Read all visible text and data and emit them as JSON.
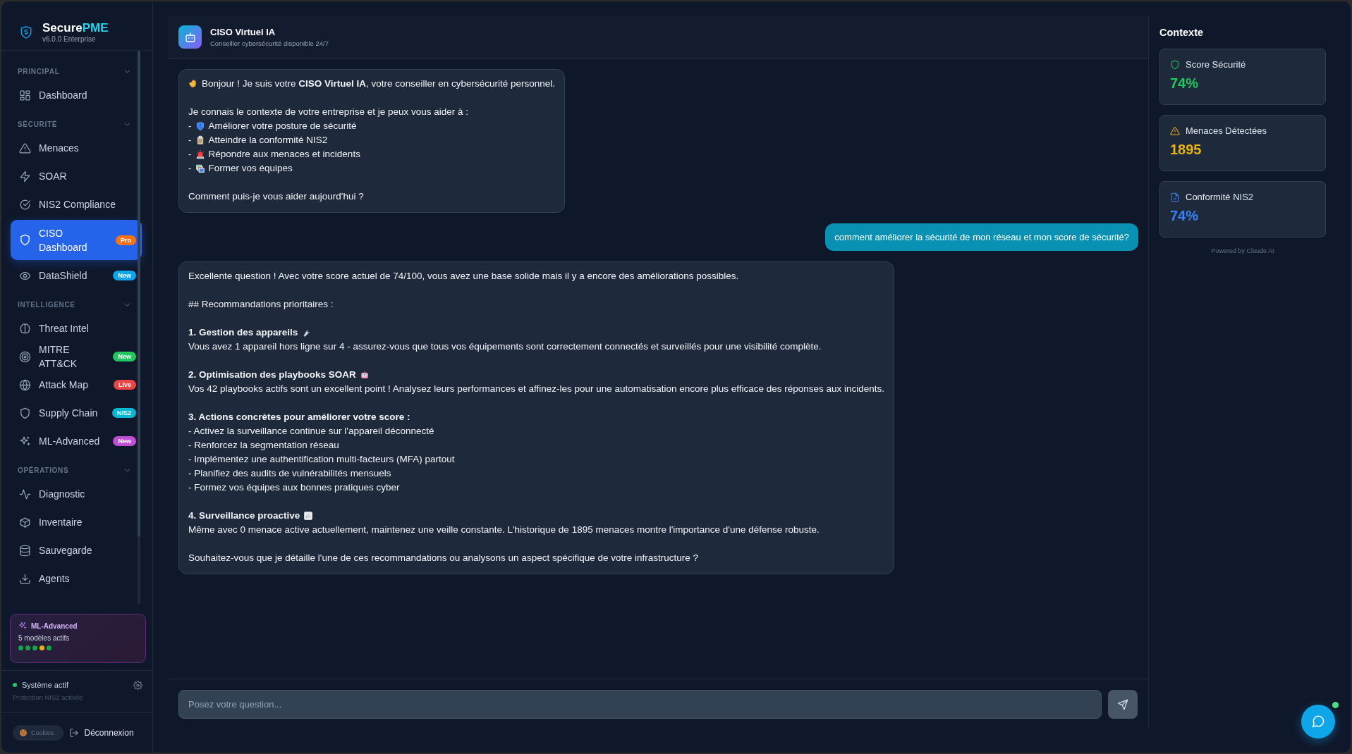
{
  "sidebar": {
    "brand": {
      "name": "Secure",
      "accent": "PME",
      "version": "v6.0.0 Enterprise"
    },
    "sections": [
      {
        "label": "PRINCIPAL",
        "expanded": true,
        "items": [
          {
            "label": "Dashboard",
            "selected": false
          }
        ]
      },
      {
        "label": "SÉCURITÉ",
        "expanded": true,
        "items": [
          {
            "label": "Menaces",
            "selected": false
          },
          {
            "label": "SOAR",
            "selected": false
          },
          {
            "label": "NIS2 Compliance",
            "selected": false
          },
          {
            "label": "CISO Dashboard",
            "selected": true,
            "badge": {
              "text": "Pro",
              "color": "#f97316"
            }
          },
          {
            "label": "DataShield",
            "selected": false,
            "badge": {
              "text": "New",
              "color": "#0ea5e9"
            }
          }
        ]
      },
      {
        "label": "INTELLIGENCE",
        "expanded": true,
        "items": [
          {
            "label": "Threat Intel",
            "selected": false
          },
          {
            "label": "MITRE ATT&CK",
            "selected": false,
            "badge": {
              "text": "New",
              "color": "#22c55e"
            }
          },
          {
            "label": "Attack Map",
            "selected": false,
            "badge": {
              "text": "Live",
              "color": "#ef4444"
            }
          },
          {
            "label": "Supply Chain",
            "selected": false,
            "badge": {
              "text": "NIS2",
              "color": "#06b6d4"
            }
          },
          {
            "label": "ML-Advanced",
            "selected": false,
            "badge": {
              "text": "New",
              "color": "#c04fd8"
            }
          }
        ]
      },
      {
        "label": "OPÉRATIONS",
        "expanded": true,
        "items": [
          {
            "label": "Diagnostic",
            "selected": false
          },
          {
            "label": "Inventaire",
            "selected": false
          },
          {
            "label": "Sauvegarde",
            "selected": false
          },
          {
            "label": "Agents",
            "selected": false
          }
        ]
      }
    ],
    "ml_card": {
      "title": "ML-Advanced",
      "subtitle": "5 modèles actifs",
      "dots": [
        {
          "color": "#16a34a"
        },
        {
          "color": "#16a34a"
        },
        {
          "color": "#16a34a"
        },
        {
          "color": "#eab308"
        },
        {
          "color": "#16a34a"
        }
      ]
    },
    "status": {
      "label": "Système actif",
      "detail": "Protection NIS2 activée",
      "active": true
    },
    "logout": "Déconnexion",
    "cookies": "Cookies"
  },
  "chat": {
    "title": "CISO Virtuel IA",
    "subtitle": "Conseiller cybersécurité disponible 24/7",
    "messages": [
      {
        "kind": "assistant",
        "paragraphs": [
          [
            {
              "kind": "text",
              "text": "Bonjour ! Je suis votre **CISO Virtuel IA**, votre conseiller en cybersécurité personnel."
            }
          ],
          [
            {
              "kind": "text",
              "text": "Je connais le contexte de votre entreprise et je peux vous aider à :"
            },
            {
              "kind": "text",
              "lead": "-",
              "text": "Améliorer votre posture de sécurité"
            },
            {
              "kind": "text",
              "lead": "-",
              "text": "Atteindre la conformité NIS2"
            },
            {
              "kind": "text",
              "lead": "-",
              "text": "Répondre aux menaces et incidents"
            },
            {
              "kind": "text",
              "lead": "-",
              "text": "Former vos équipes"
            }
          ],
          [
            {
              "kind": "text",
              "text": "Comment puis-je vous aider aujourd'hui ?"
            }
          ]
        ]
      },
      {
        "kind": "user",
        "text": "comment améliorer la sécurité de mon réseau et mon score de sécurité?"
      },
      {
        "kind": "assistant",
        "paragraphs": [
          [
            {
              "kind": "text",
              "text": "Excellente question ! Avec votre score actuel de 74/100, vous avez une base solide mais il y a encore des améliorations possibles."
            }
          ],
          [
            {
              "kind": "text",
              "text": "## Recommandations prioritaires :"
            }
          ],
          [
            {
              "kind": "heading",
              "text": "1. Gestion des appareils"
            },
            {
              "kind": "text",
              "text": "Vous avez 1 appareil hors ligne sur 4 - assurez-vous que tous vos équipements sont correctement connectés et surveillés pour une visibilité complète."
            }
          ],
          [
            {
              "kind": "heading",
              "text": "2. Optimisation des playbooks SOAR"
            },
            {
              "kind": "text",
              "text": "Vos 42 playbooks actifs sont un excellent point ! Analysez leurs performances et affinez-les pour une automatisation encore plus efficace des réponses aux incidents."
            }
          ],
          [
            {
              "kind": "heading",
              "text": "3. Actions concrètes pour améliorer votre score :"
            },
            {
              "kind": "text",
              "text": "- Activez la surveillance continue sur l'appareil déconnecté"
            },
            {
              "kind": "text",
              "text": "- Renforcez la segmentation réseau"
            },
            {
              "kind": "text",
              "text": "- Implémentez une authentification multi-facteurs (MFA) partout"
            },
            {
              "kind": "text",
              "text": "- Planifiez des audits de vulnérabilités mensuels"
            },
            {
              "kind": "text",
              "text": "- Formez vos équipes aux bonnes pratiques cyber"
            }
          ],
          [
            {
              "kind": "heading",
              "text": "4. Surveillance proactive"
            },
            {
              "kind": "text",
              "text": "Même avec 0 menace active actuellement, maintenez une veille constante. L'historique de 1895 menaces montre l'importance d'une défense robuste."
            }
          ],
          [
            {
              "kind": "text",
              "text": "Souhaitez-vous que je détaille l'une de ces recommandations ou analysons un aspect spécifique de votre infrastructure ?"
            }
          ]
        ]
      }
    ],
    "input": {
      "placeholder": "Posez votre question..."
    }
  },
  "context": {
    "title": "Contexte",
    "cards": [
      {
        "label": "Score Sécurité",
        "value": "74%",
        "color": "#22c55e"
      },
      {
        "label": "Menaces Détectées",
        "value": "1895",
        "color": "#eab308"
      },
      {
        "label": "Conformité NIS2",
        "value": "74%",
        "color": "#3b82f6"
      }
    ],
    "footer": "Powered by Claude AI"
  },
  "chat_widget": {
    "online": true
  }
}
